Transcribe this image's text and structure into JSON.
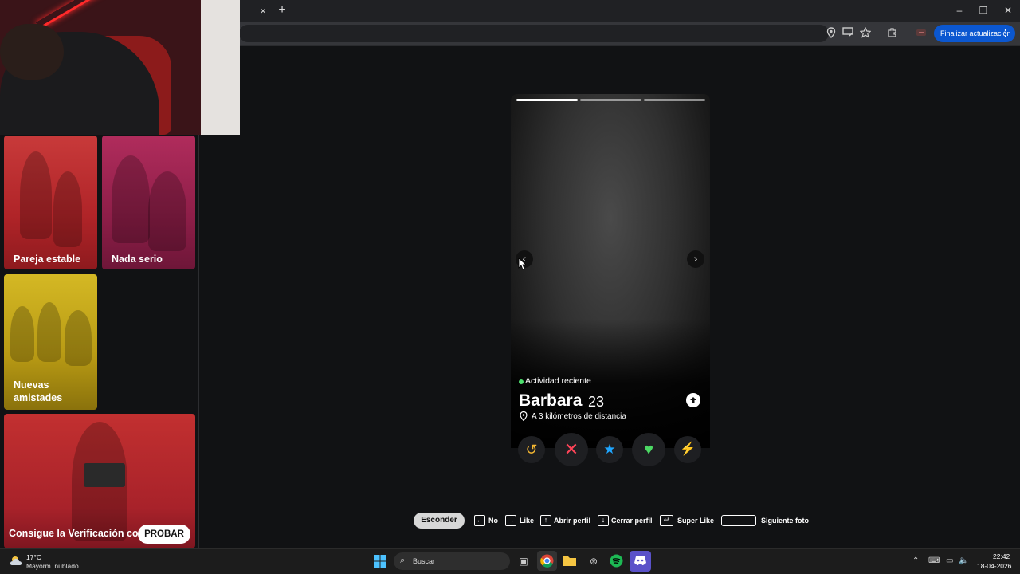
{
  "browser": {
    "new_tab": "+",
    "tab_close": "×",
    "window_controls": {
      "minimize": "–",
      "maximize": "❐",
      "close": "✕"
    },
    "update_button": "Finalizar actualización",
    "icons": [
      "location-icon",
      "cast-icon",
      "star-icon",
      "extensions-icon",
      "profile-icon",
      "menu-icon"
    ]
  },
  "sidebar": {
    "cards": [
      {
        "label": "Pareja estable"
      },
      {
        "label": "Nada serio"
      },
      {
        "label": "Nuevas amistades"
      },
      {
        "label": "Consigue la Verificación co",
        "button": "PROBAR"
      }
    ]
  },
  "profile": {
    "photo_count": 3,
    "active_photo_index": 1,
    "activity": "Actividad reciente",
    "name": "Barbara",
    "age": "23",
    "distance": "A 3 kilómetros de distancia",
    "nav_prev": "‹",
    "nav_next": "›",
    "actions": {
      "rewind": "↺",
      "nope": "✕",
      "super_like": "★",
      "like": "♥",
      "boost": "⚡"
    },
    "colors": {
      "rewind": "#f5b731",
      "nope": "#ff4458",
      "super_like": "#1fa6ff",
      "like": "#4cd964",
      "boost": "#c040ff",
      "activity_dot": "#4ddf6e"
    }
  },
  "hints": {
    "hide": "Esconder",
    "items": [
      {
        "key": "←",
        "label": "No"
      },
      {
        "key": "→",
        "label": "Like"
      },
      {
        "key": "↑",
        "label": "Abrir perfil"
      },
      {
        "key": "↓",
        "label": "Cerrar perfil"
      },
      {
        "key": "↵",
        "label": "Super Like"
      },
      {
        "key": "",
        "label": "Siguiente foto"
      }
    ]
  },
  "taskbar": {
    "weather_temp": "17°C",
    "weather_desc": "Mayorm. nublado",
    "search": "Buscar",
    "time": "22:42",
    "date": "18-04-2026"
  }
}
